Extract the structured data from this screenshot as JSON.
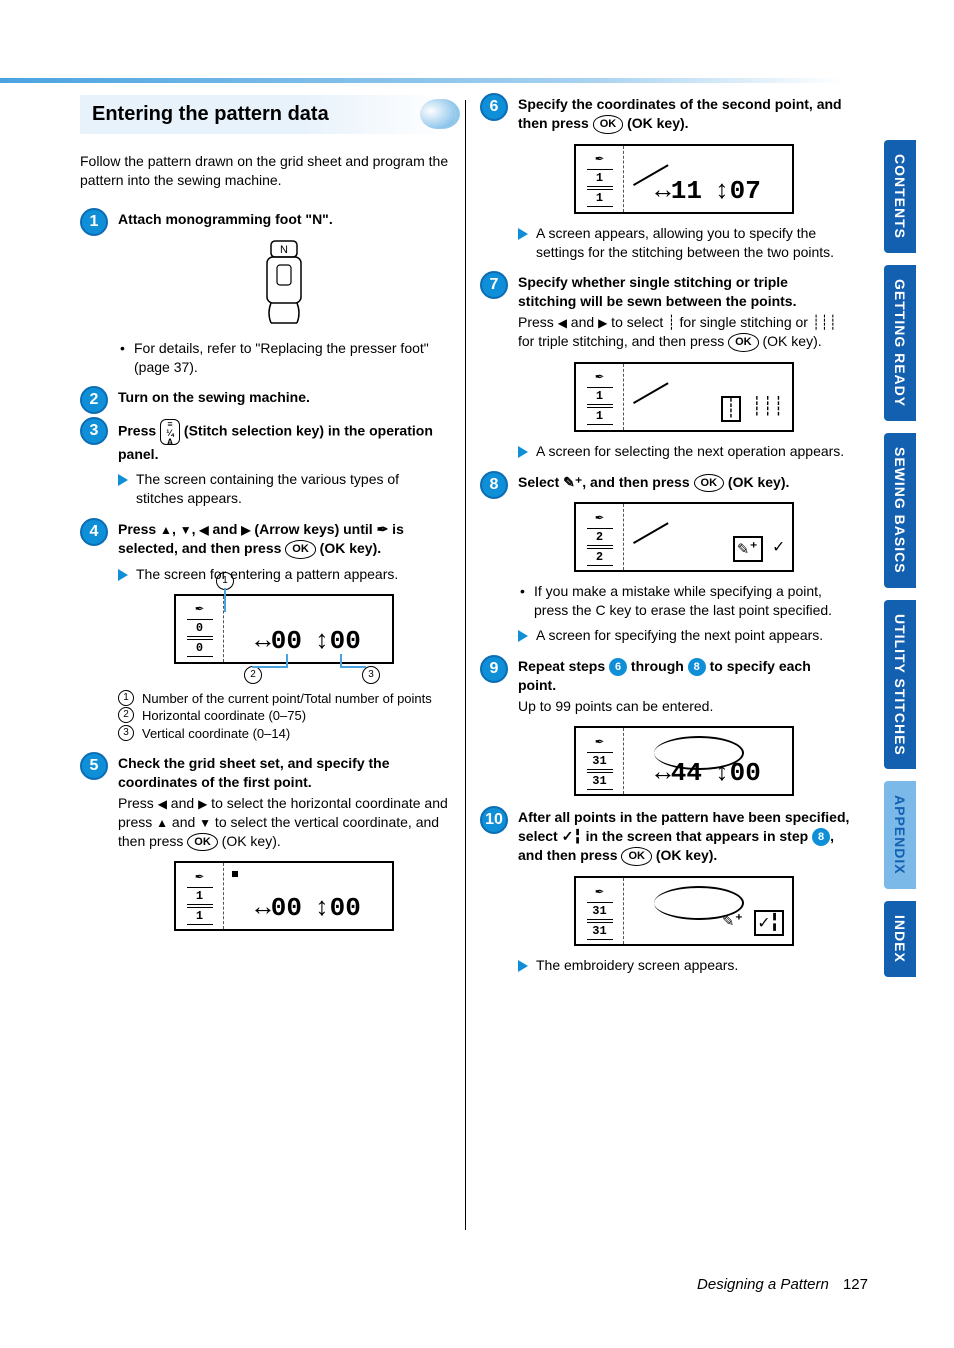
{
  "header": {
    "title": "Entering the pattern data"
  },
  "intro": "Follow the pattern drawn on the grid sheet and program the pattern into the sewing machine.",
  "steps": {
    "s1": {
      "title": "Attach monogramming foot \"N\".",
      "detail": "For details, refer to \"Replacing the presser foot\" (page 37)."
    },
    "s2": {
      "title": "Turn on the sewing machine."
    },
    "s3": {
      "title_a": "Press ",
      "title_b": " (Stitch selection key) in the operation panel.",
      "result": "The screen containing the various types of stitches appears."
    },
    "s4": {
      "title_a": "Press ",
      "title_b": " (Arrow keys) until ",
      "title_c": " is selected, and then press ",
      "title_d": " (OK key).",
      "result": "The screen for entering a pattern appears."
    },
    "s5": {
      "title": "Check the grid sheet set, and specify the coordinates of the first point.",
      "body_a": "Press ",
      "body_b": " and ",
      "body_c": " to select the horizontal coordinate and press ",
      "body_d": " and ",
      "body_e": " to select the vertical coordinate, and then press ",
      "body_f": " (OK key)."
    },
    "s6": {
      "title_a": "Specify the coordinates of the second point, and then press ",
      "title_b": " (OK key).",
      "result": "A screen appears, allowing you to specify the settings for the stitching between the two points."
    },
    "s7": {
      "title": "Specify whether single stitching or triple stitching will be sewn between the points.",
      "body_a": "Press ",
      "body_b": " and ",
      "body_c": " to select ",
      "body_d": " for single stitching or ",
      "body_e": " for triple stitching, and then press ",
      "body_f": " (OK key).",
      "result": "A screen for selecting the next operation appears."
    },
    "s8": {
      "title_a": "Select ",
      "title_b": ", and then press ",
      "title_c": " (OK key).",
      "note": "If you make a mistake while specifying a point, press the C key to erase the last point specified.",
      "result": "A screen for specifying the next point appears."
    },
    "s9": {
      "title_a": "Repeat steps ",
      "title_b": " through ",
      "title_c": " to specify each point.",
      "body": "Up to 99 points can be entered."
    },
    "s10": {
      "title_a": "After all points in the pattern have been specified, select ",
      "title_b": " in the screen that appears in step ",
      "title_c": ", and then press ",
      "title_d": " (OK key).",
      "result": "The embroidery screen appears."
    }
  },
  "legend": {
    "l1": "Number of the current point/Total number of points",
    "l2": "Horizontal coordinate (0–75)",
    "l3": "Vertical coordinate (0–14)"
  },
  "lcd": {
    "a": {
      "top": "0",
      "bot": "0",
      "h": "00",
      "v": "00"
    },
    "b": {
      "top": "1",
      "bot": "1",
      "h": "00",
      "v": "00"
    },
    "c": {
      "top": "1",
      "bot": "1",
      "h": "11",
      "v": "07"
    },
    "d": {
      "top": "1",
      "bot": "1"
    },
    "e": {
      "top": "2",
      "bot": "2"
    },
    "f": {
      "top": "31",
      "bot": "31",
      "h": "44",
      "v": "00"
    },
    "g": {
      "top": "31",
      "bot": "31"
    }
  },
  "sidebar": {
    "t1": "CONTENTS",
    "t2": "GETTING READY",
    "t3": "SEWING BASICS",
    "t4": "UTILITY STITCHES",
    "t5": "APPENDIX",
    "t6": "INDEX"
  },
  "footer": {
    "section": "Designing a Pattern",
    "page": "127"
  }
}
